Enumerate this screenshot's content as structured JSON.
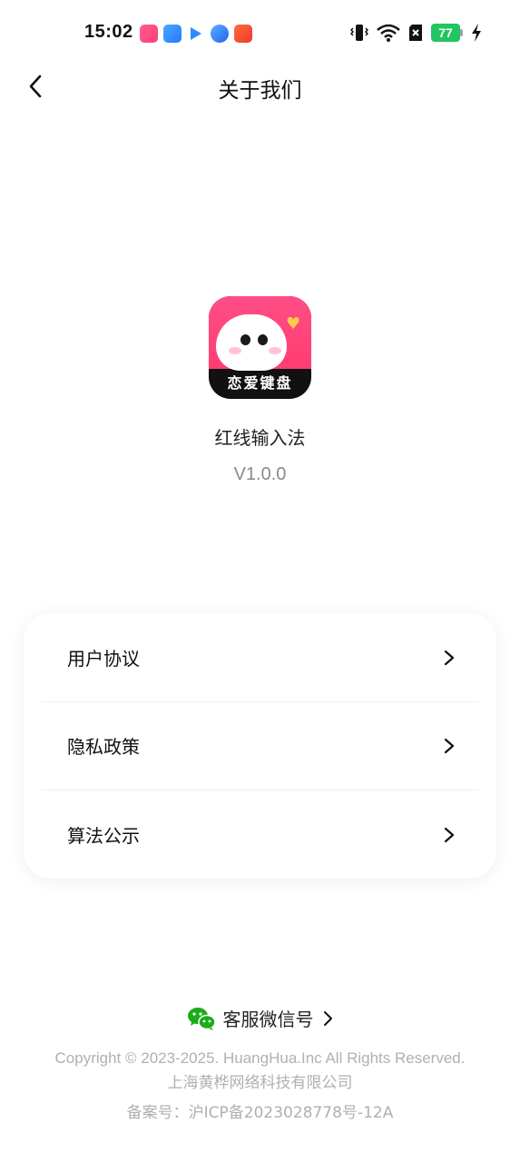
{
  "status_bar": {
    "time": "15:02",
    "battery_level": "77",
    "notification_icons": [
      "xiaohongshu-icon",
      "calendar-app-icon",
      "play-arrow-app-icon",
      "browser-app-icon",
      "video-app-icon"
    ],
    "system_icons": [
      "vibrate-icon",
      "wifi-icon",
      "no-sim-icon",
      "battery-icon",
      "charging-icon"
    ]
  },
  "header": {
    "title": "关于我们",
    "back_icon": "chevron-left-icon"
  },
  "app": {
    "icon_text": "恋爱键盘",
    "name": "红线输入法",
    "version": "V1.0.0"
  },
  "menu": {
    "items": [
      {
        "label": "用户协议"
      },
      {
        "label": "隐私政策"
      },
      {
        "label": "算法公示"
      }
    ]
  },
  "footer": {
    "wechat_label": "客服微信号",
    "copyright": "Copyright © 2023-2025. HuangHua.Inc All Rights Reserved.",
    "company": "上海黄桦网络科技有限公司",
    "icp": "备案号：沪ICP备2023028778号-12A"
  },
  "colors": {
    "brand_pink": "#ff3d72",
    "battery_green": "#22c55e",
    "wechat_green": "#1aad19",
    "muted_text": "#b0b0b0"
  }
}
